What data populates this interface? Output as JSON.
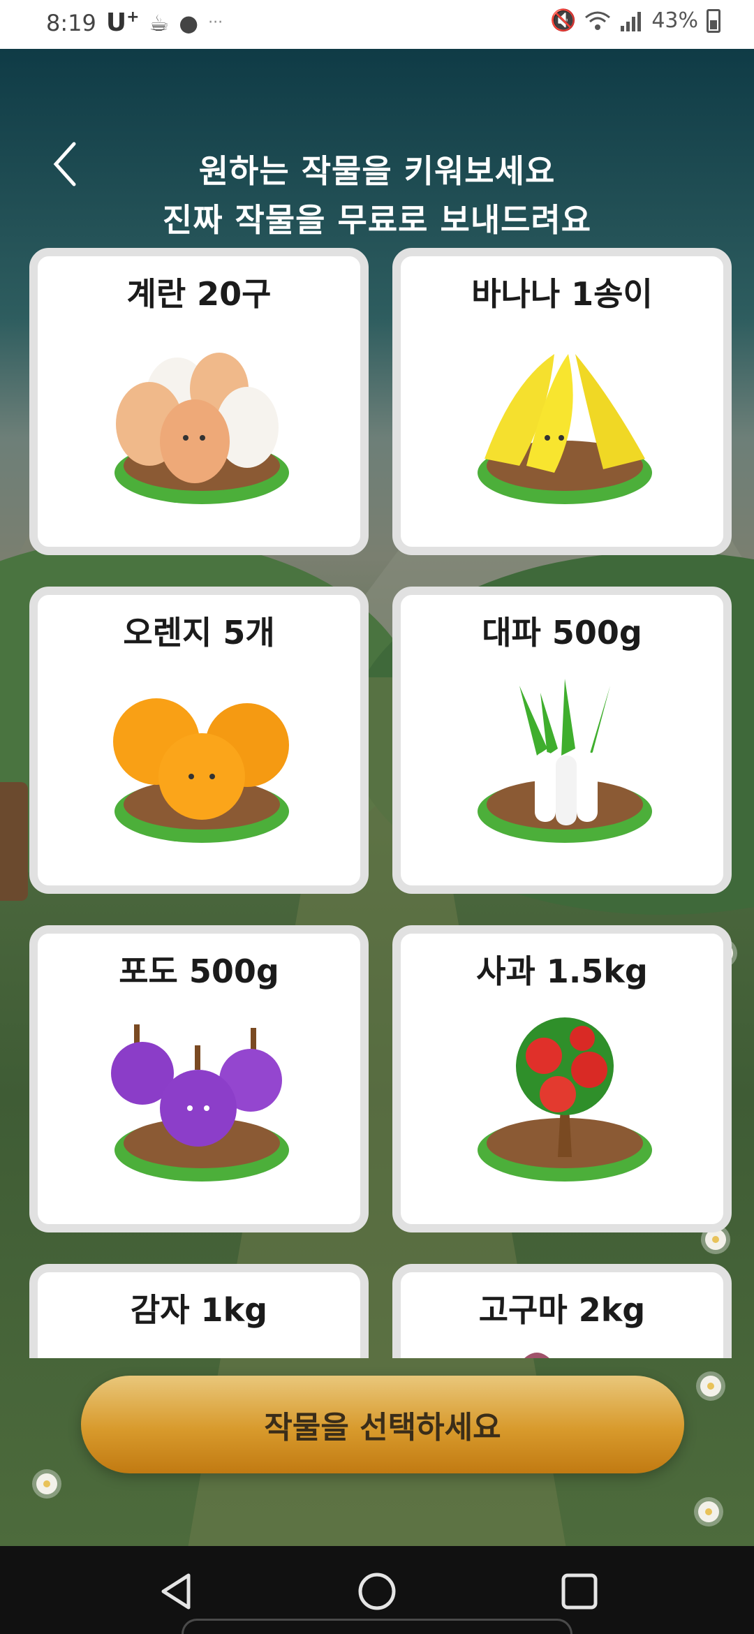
{
  "status_bar": {
    "time": "8:19",
    "carrier": "U",
    "carrier_sup": "+",
    "more": "···",
    "battery": "43%"
  },
  "header": {
    "back_icon": "chevron-left-icon",
    "line1": "원하는 작물을 키워보세요",
    "line2": "진짜 작물을 무료로 보내드려요"
  },
  "crops": [
    {
      "title": "계란 20구",
      "icon": "eggs"
    },
    {
      "title": "바나나 1송이",
      "icon": "bananas"
    },
    {
      "title": "오렌지 5개",
      "icon": "oranges"
    },
    {
      "title": "대파 500g",
      "icon": "green-onions"
    },
    {
      "title": "포도 500g",
      "icon": "grapes"
    },
    {
      "title": "사과 1.5kg",
      "icon": "apple-tree"
    },
    {
      "title": "감자 1kg",
      "icon": "potatoes"
    },
    {
      "title": "고구마 2kg",
      "icon": "sweet-potatoes"
    }
  ],
  "cta": {
    "label": "작물을 선택하세요"
  },
  "colors": {
    "cta": "#d89a2c",
    "card_border": "#e1e1e1",
    "grass": "#4caf3a",
    "soil": "#8b5a34"
  }
}
